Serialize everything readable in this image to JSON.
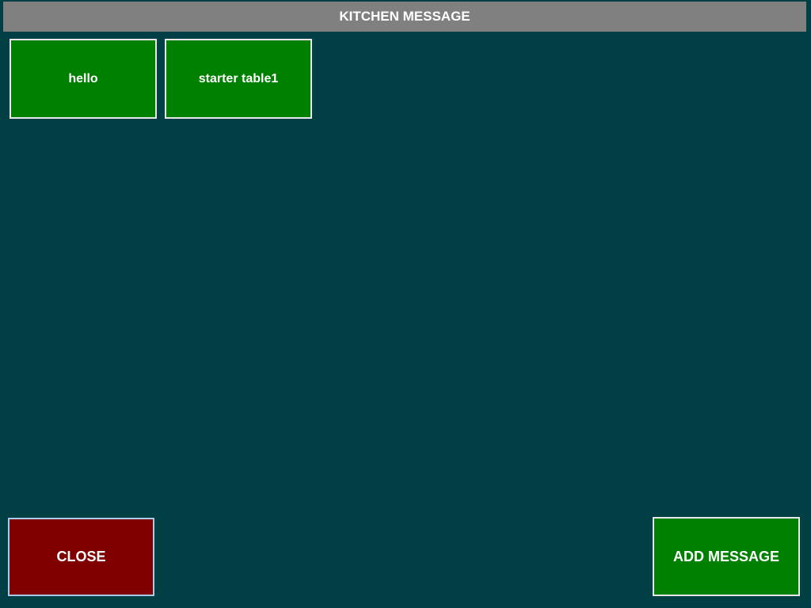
{
  "header": {
    "title": "KITCHEN MESSAGE"
  },
  "messages": [
    {
      "label": "hello"
    },
    {
      "label": "starter table1"
    }
  ],
  "footer": {
    "close_label": "CLOSE",
    "add_label": "ADD MESSAGE"
  },
  "colors": {
    "background": "#004044",
    "header": "#808080",
    "message": "#008000",
    "close": "#800000",
    "add": "#008000"
  }
}
